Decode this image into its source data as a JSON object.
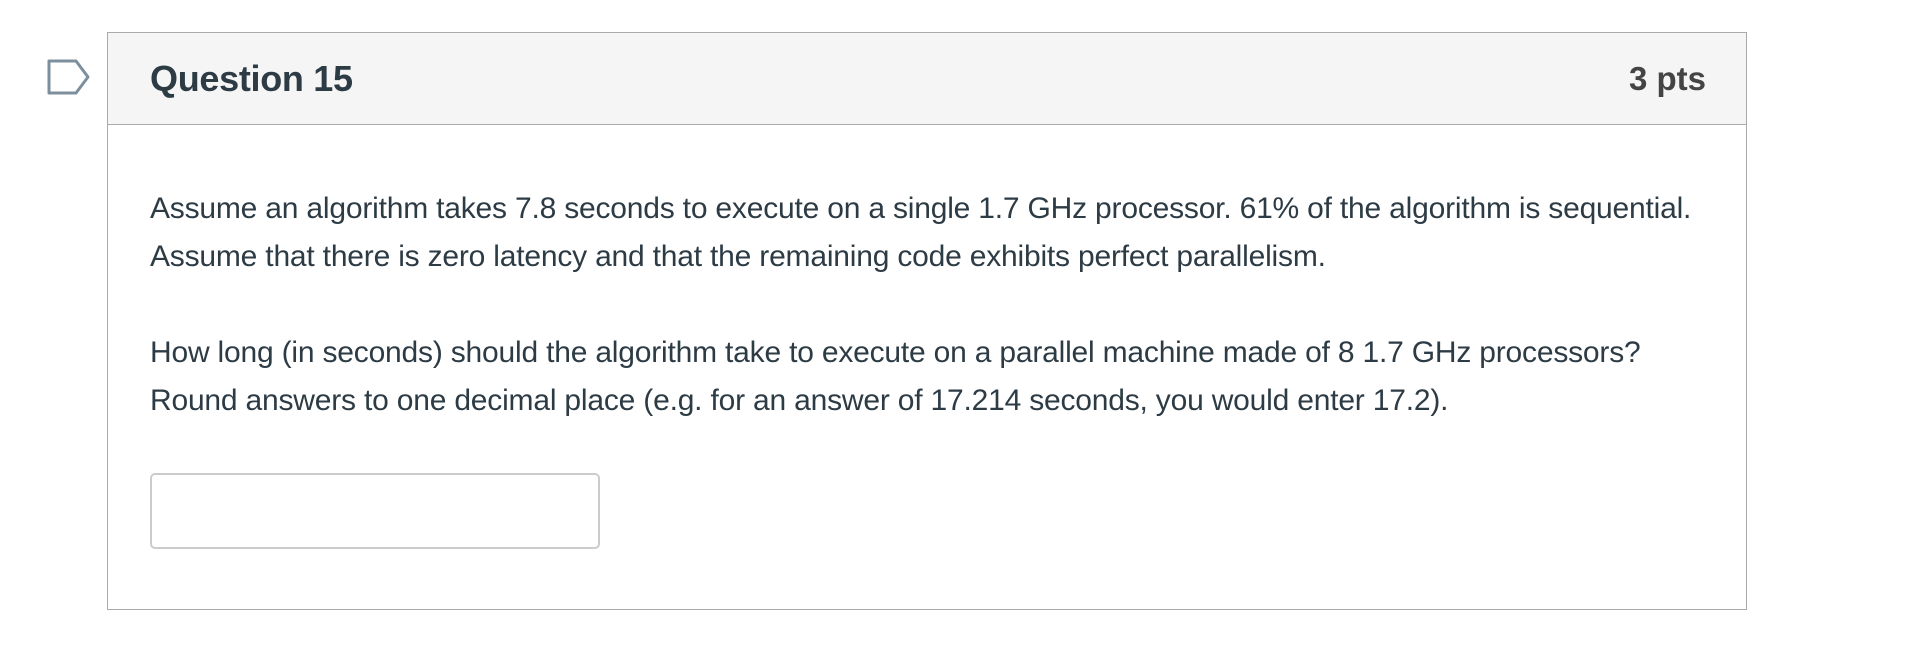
{
  "flag": {
    "icon": "flag-outline-icon",
    "color": "#7d8f9c"
  },
  "question": {
    "title": "Question 15",
    "points": "3 pts",
    "paragraphs": [
      "Assume an algorithm takes 7.8 seconds to execute on a single 1.7 GHz processor. 61% of the algorithm is sequential. Assume that there is zero latency and that the remaining code exhibits perfect parallelism.",
      "How long (in seconds) should the algorithm take to execute on a parallel machine made of 8 1.7 GHz processors? Round answers to one decimal place (e.g. for an answer of 17.214 seconds, you would enter 17.2)."
    ],
    "answer": {
      "value": "",
      "placeholder": ""
    }
  }
}
